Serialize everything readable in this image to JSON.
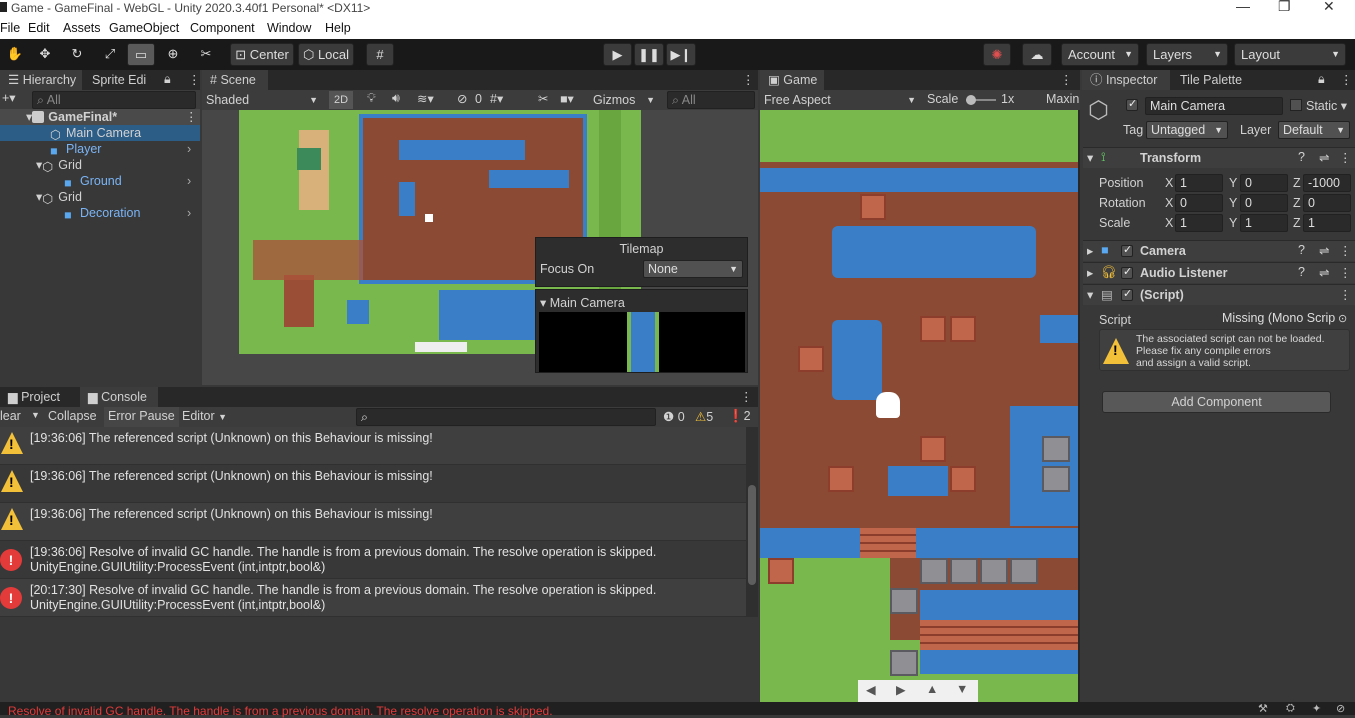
{
  "title": "Game - GameFinal - WebGL - Unity 2020.3.40f1 Personal* <DX11>",
  "window_controls": {
    "minimize": "—",
    "maximize": "❐",
    "close": "✕"
  },
  "menu": [
    "File",
    "Edit",
    "Assets",
    "GameObject",
    "Component",
    "Window",
    "Help"
  ],
  "toolbar": {
    "pivot": "Center",
    "space": "Local",
    "account": "Account",
    "layers": "Layers",
    "layout": "Layout"
  },
  "hierarchy": {
    "tabs": [
      "Hierarchy",
      "Sprite Edi"
    ],
    "search_placeholder": "All",
    "scene": "GameFinal*",
    "items": [
      {
        "label": "Main Camera",
        "prefab": false
      },
      {
        "label": "Player",
        "prefab": true
      },
      {
        "label": "Grid",
        "prefab": false
      },
      {
        "label": "Ground",
        "prefab": true
      },
      {
        "label": "Grid",
        "prefab": false
      },
      {
        "label": "Decoration",
        "prefab": true
      }
    ]
  },
  "scene": {
    "tab": "Scene",
    "shading": "Shaded",
    "mode_2d": "2D",
    "hidden_count": "0",
    "gizmos": "Gizmos",
    "search_placeholder": "All",
    "tilemap_overlay": {
      "title": "Tilemap",
      "focus_label": "Focus On",
      "focus_value": "None"
    },
    "camera_preview_title": "Main Camera"
  },
  "game": {
    "tab": "Game",
    "aspect": "Free Aspect",
    "scale_label": "Scale",
    "scale_value": "1x",
    "maximize": "Maxin"
  },
  "inspector": {
    "tabs": [
      "Inspector",
      "Tile Palette"
    ],
    "object_name": "Main Camera",
    "static_label": "Static",
    "tag_label": "Tag",
    "tag_value": "Untagged",
    "layer_label": "Layer",
    "layer_value": "Default",
    "transform": {
      "title": "Transform",
      "position": {
        "label": "Position",
        "x": "1",
        "y": "0",
        "z": "-1000"
      },
      "rotation": {
        "label": "Rotation",
        "x": "0",
        "y": "0",
        "z": "0"
      },
      "scale": {
        "label": "Scale",
        "x": "1",
        "y": "1",
        "z": "1"
      }
    },
    "components": [
      "Camera",
      "Audio Listener",
      "(Script)"
    ],
    "script_label": "Script",
    "script_value": "Missing (Mono Scrip",
    "warning": [
      "The associated script can not be loaded.",
      "Please fix any compile errors",
      "and assign a valid script."
    ],
    "add_component": "Add Component"
  },
  "console": {
    "tabs": [
      "Project",
      "Console"
    ],
    "buttons": {
      "clear": "lear",
      "collapse": "Collapse",
      "error_pause": "Error Pause",
      "editor": "Editor"
    },
    "counts": {
      "info": "0",
      "warn": "5",
      "error": "2"
    },
    "logs": [
      {
        "type": "warn",
        "line1": "[19:36:06] The referenced script (Unknown) on this Behaviour is missing!",
        "line2": ""
      },
      {
        "type": "warn",
        "line1": "[19:36:06] The referenced script (Unknown) on this Behaviour is missing!",
        "line2": ""
      },
      {
        "type": "warn",
        "line1": "[19:36:06] The referenced script (Unknown) on this Behaviour is missing!",
        "line2": ""
      },
      {
        "type": "error",
        "line1": "[19:36:06] Resolve of invalid GC handle. The handle is from a previous domain. The resolve operation is skipped.",
        "line2": "UnityEngine.GUIUtility:ProcessEvent (int,intptr,bool&)"
      },
      {
        "type": "error",
        "line1": "[20:17:30] Resolve of invalid GC handle. The handle is from a previous domain. The resolve operation is skipped.",
        "line2": "UnityEngine.GUIUtility:ProcessEvent (int,intptr,bool&)"
      }
    ]
  },
  "statusbar": {
    "message": "Resolve of invalid GC handle. The handle is from a previous domain. The resolve operation is skipped."
  },
  "colors": {
    "error": "#e33a3a",
    "warning": "#f3c03a",
    "selection": "#2c5d87",
    "prefab": "#7ab4f5"
  }
}
